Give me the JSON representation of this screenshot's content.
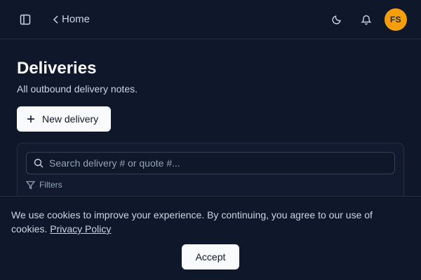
{
  "header": {
    "breadcrumb_home": "Home",
    "user_initials": "FS",
    "avatar_color": "#f59e0b"
  },
  "page": {
    "title": "Deliveries",
    "subtitle": "All outbound delivery notes.",
    "new_button_label": "New delivery"
  },
  "filters": {
    "search_placeholder": "Search delivery # or quote #...",
    "filters_label": "Filters"
  },
  "cookie_banner": {
    "text": "We use cookies to improve your experience. By continuing, you agree to our use of cookies.",
    "policy_link": "Privacy Policy",
    "accept_label": "Accept"
  },
  "icons": {
    "sidebar": "sidebar-toggle-icon",
    "back": "chevron-left-icon",
    "theme": "moon-icon",
    "notifications": "bell-icon",
    "add": "plus-icon",
    "search": "search-icon",
    "filter": "filter-icon"
  },
  "colors": {
    "background": "#0f172a",
    "border": "#243047",
    "button_bg": "#f8fafc"
  }
}
